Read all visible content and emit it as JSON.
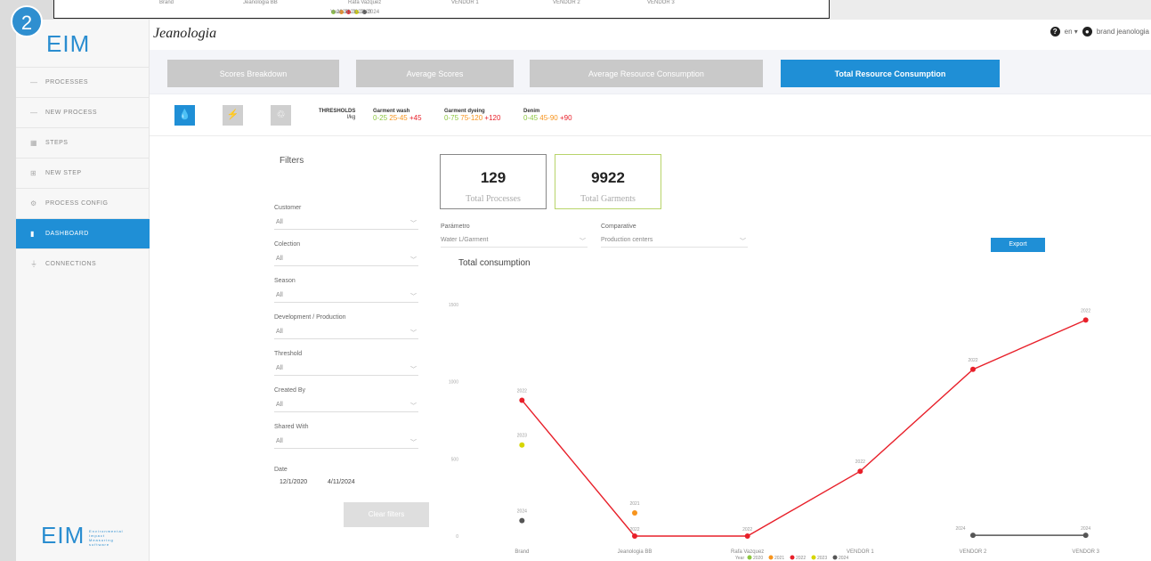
{
  "badge": "2",
  "prev": {
    "labels": [
      "Brand",
      "Jeanologia BB",
      "Rafa Vazquez",
      "VENDOR 1",
      "VENDOR 2",
      "VENDOR 3"
    ],
    "legend_title": "Year",
    "legend": [
      "2020",
      "2021",
      "2022",
      "2023",
      "2024"
    ]
  },
  "sidebar": {
    "logo": "EIM",
    "items": [
      {
        "label": "PROCESSES",
        "icon": "dash-icon"
      },
      {
        "label": "NEW PROCESS",
        "icon": "dash-icon"
      },
      {
        "label": "STEPS",
        "icon": "grid-icon"
      },
      {
        "label": "NEW STEP",
        "icon": "plus-box-icon"
      },
      {
        "label": "PROCESS CONFIG",
        "icon": "gear-icon"
      },
      {
        "label": "DASHBOARD",
        "icon": "bar-chart-icon"
      },
      {
        "label": "CONNECTIONS",
        "icon": "plug-icon"
      }
    ],
    "active_index": 5,
    "footer_logo": "EIM",
    "footer_tagline": "Environmental Impact Measuring software"
  },
  "header": {
    "brand": "Jeanologia",
    "lang": "en",
    "user": "brand jeanologia"
  },
  "tabs": [
    "Scores Breakdown",
    "Average Scores",
    "Average Resource Consumption",
    "Total Resource Consumption"
  ],
  "active_tab": 3,
  "thresholds": {
    "title": "THRESHOLDS",
    "unit": "l/kg",
    "groups": [
      {
        "name": "Garment wash",
        "green": "0-25",
        "orange": "25-45",
        "red": "+45"
      },
      {
        "name": "Garment dyeing",
        "green": "0-75",
        "orange": "75-120",
        "red": "+120"
      },
      {
        "name": "Denim",
        "green": "0-45",
        "orange": "45-90",
        "red": "+90"
      }
    ],
    "colors": {
      "green": "#8cc63f",
      "orange": "#f7941d",
      "red": "#e8202a"
    }
  },
  "filters": {
    "title": "Filters",
    "fields": [
      {
        "label": "Customer",
        "value": "All"
      },
      {
        "label": "Colection",
        "value": "All"
      },
      {
        "label": "Season",
        "value": "All"
      },
      {
        "label": "Development / Production",
        "value": "All"
      },
      {
        "label": "Threshold",
        "value": "All"
      },
      {
        "label": "Created By",
        "value": "All"
      },
      {
        "label": "Shared With",
        "value": "All"
      }
    ],
    "date_label": "Date",
    "date_from": "12/1/2020",
    "date_to": "4/11/2024",
    "clear_label": "Clear filters"
  },
  "kpis": {
    "processes_value": "129",
    "processes_label": "Total Processes",
    "garments_value": "9922",
    "garments_label": "Total Garments"
  },
  "controls": {
    "param_label": "Parámetro",
    "param_value": "Water L/Garment",
    "comp_label": "Comparative",
    "comp_value": "Production centers",
    "export_label": "Export"
  },
  "chart_title": "Total consumption",
  "chart_data": {
    "type": "line",
    "categories": [
      "Brand",
      "Jeanologia BB",
      "Rafa Vazquez",
      "VENDOR 1",
      "VENDOR 2",
      "VENDOR 3"
    ],
    "ylim": [
      0,
      1500
    ],
    "yticks": [
      0,
      500,
      1000,
      1500
    ],
    "ytick_labels": [
      "0",
      "500",
      "1000",
      "1500"
    ],
    "series": [
      {
        "name": "2020",
        "color": "#8cc63f",
        "values": [
          null,
          null,
          null,
          null,
          null,
          null
        ]
      },
      {
        "name": "2021",
        "color": "#f7941d",
        "values": [
          null,
          150,
          null,
          null,
          null,
          null
        ]
      },
      {
        "name": "2022",
        "color": "#e8202a",
        "values": [
          880,
          0,
          0,
          420,
          1080,
          1400
        ]
      },
      {
        "name": "2023",
        "color": "#d7d600",
        "values": [
          590,
          null,
          null,
          null,
          null,
          null
        ]
      },
      {
        "name": "2024",
        "color": "#555555",
        "values": [
          100,
          null,
          null,
          null,
          5,
          5
        ]
      }
    ],
    "point_labels": [
      {
        "cat": 0,
        "series": "2022",
        "text": "2022"
      },
      {
        "cat": 0,
        "series": "2023",
        "text": "2023"
      },
      {
        "cat": 0,
        "series": "2024",
        "text": "2024"
      },
      {
        "cat": 1,
        "series": "2021",
        "text": "2021"
      },
      {
        "cat": 1,
        "series": "2022",
        "text": "2022"
      },
      {
        "cat": 2,
        "series": "2022",
        "text": "2022"
      },
      {
        "cat": 3,
        "series": "2022",
        "text": "2022"
      },
      {
        "cat": 4,
        "series": "2022",
        "text": "2022"
      },
      {
        "cat": 4,
        "series": "2024",
        "text": "2024"
      },
      {
        "cat": 5,
        "series": "2022",
        "text": "2022"
      },
      {
        "cat": 5,
        "series": "2024",
        "text": "2024"
      }
    ],
    "legend_title": "Year",
    "legend_placement": "bottom"
  }
}
